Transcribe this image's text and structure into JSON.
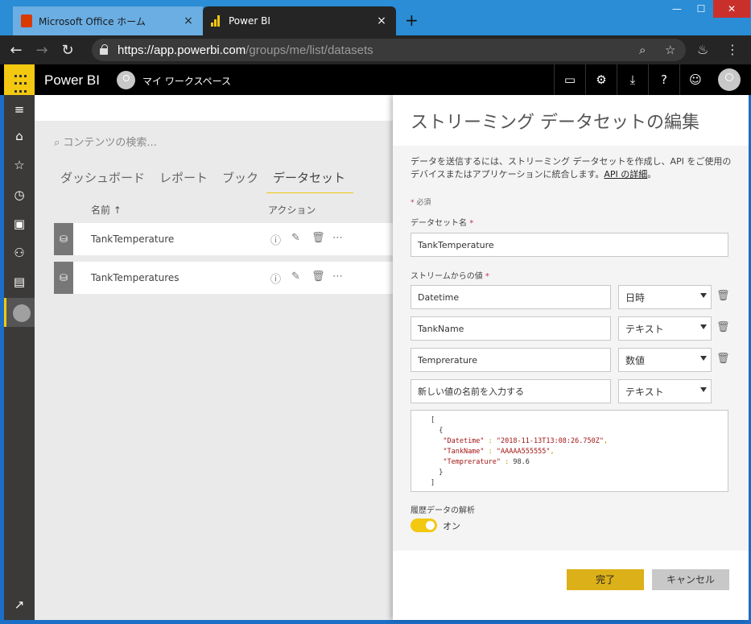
{
  "browser": {
    "tabs": [
      {
        "title": "Microsoft Office ホーム",
        "close": "×"
      },
      {
        "title": "Power BI",
        "close": "×"
      }
    ],
    "new_tab": "+",
    "window_controls": {
      "minimize": "—",
      "maximize": "☐",
      "close": "✕"
    },
    "url_host": "https://app.powerbi.com",
    "url_path": "/groups/me/list/datasets"
  },
  "appbar": {
    "title": "Power BI",
    "workspace": "マイ ワークスペース",
    "help_label": "?"
  },
  "content": {
    "search_placeholder": "コンテンツの検索...",
    "tabs": [
      {
        "label": "ダッシュボード"
      },
      {
        "label": "レポート"
      },
      {
        "label": "ブック"
      },
      {
        "label": "データセット"
      }
    ],
    "columns": {
      "name": "名前",
      "sort_indicator": "↑",
      "actions": "アクション"
    },
    "rows": [
      {
        "name": "TankTemperature"
      },
      {
        "name": "TankTemperatures"
      }
    ]
  },
  "panel": {
    "title": "ストリーミング データセットの編集",
    "description": "データを送信するには、ストリーミング データセットを作成し、API をご使用のデバイスまたはアプリケーションに統合します。",
    "api_link": "API の詳細",
    "required_mark": "*",
    "required_note": "必須",
    "dataset_name_label": "データセット名",
    "dataset_name_value": "TankTemperature",
    "values_label": "ストリームからの値",
    "fields": [
      {
        "name": "Datetime",
        "type": "日時"
      },
      {
        "name": "TankName",
        "type": "テキスト"
      },
      {
        "name": "Temprerature",
        "type": "数値"
      }
    ],
    "new_field_placeholder": "新しい値の名前を入力する",
    "new_field_type": "テキスト",
    "json_lines": {
      "open_bracket": "[",
      "open_brace": "{",
      "datetime_key": "\"Datetime\"",
      "datetime_value": "\"2018-11-13T13:08:26.750Z\"",
      "tankname_key": "\"TankName\"",
      "tankname_value": "\"AAAAA555555\"",
      "temp_key": "\"Temprerature\"",
      "temp_value": "98.6",
      "close_brace": "}",
      "close_bracket": "]"
    },
    "history_label": "履歴データの解析",
    "history_toggle": "オン",
    "done_button": "完了",
    "cancel_button": "キャンセル"
  }
}
